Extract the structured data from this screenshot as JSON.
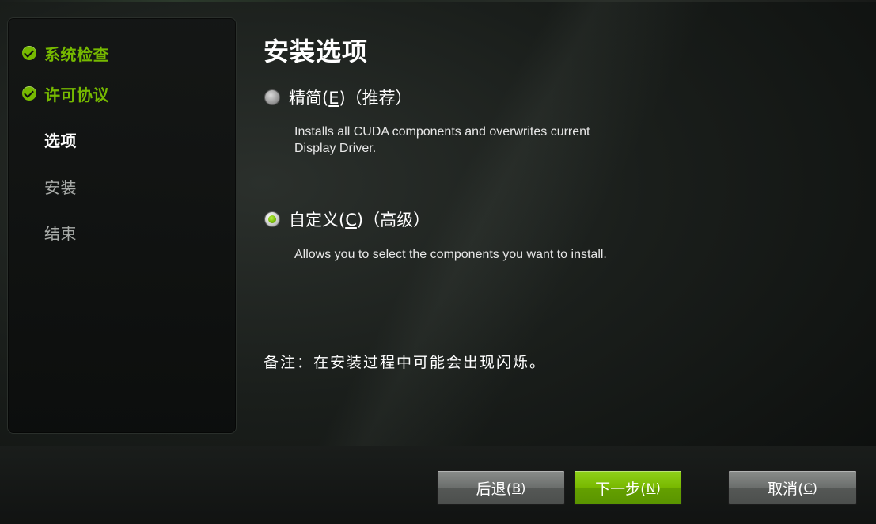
{
  "sidebar": {
    "steps": [
      {
        "label": "系统检查",
        "state": "done"
      },
      {
        "label": "许可协议",
        "state": "done"
      },
      {
        "label": "选项",
        "state": "current"
      },
      {
        "label": "安装",
        "state": "pending"
      },
      {
        "label": "结束",
        "state": "pending"
      }
    ]
  },
  "main": {
    "title": "安装选项",
    "options": [
      {
        "label_prefix": "精简(",
        "shortcut": "E",
        "label_suffix": ")（推荐）",
        "description_line1": "Installs all CUDA components and overwrites current",
        "description_line2": "Display Driver.",
        "selected": false
      },
      {
        "label_prefix": "自定义(",
        "shortcut": "C",
        "label_suffix": ")（高级）",
        "description_line1": "Allows you to select the components you want to install.",
        "selected": true
      }
    ],
    "note": "备注：在安装过程中可能会出现闪烁。"
  },
  "footer": {
    "back": {
      "label": "后退(",
      "shortcut": "B",
      "suffix": ")"
    },
    "next": {
      "label": "下一步(",
      "shortcut": "N",
      "suffix": ")"
    },
    "cancel": {
      "label": "取消(",
      "shortcut": "C",
      "suffix": ")"
    }
  },
  "colors": {
    "accent_green": "#76b900",
    "background": "#101311",
    "pending_text": "#a8aba8"
  },
  "icons": {
    "done_step": "check-circle-icon",
    "option_radio": "radio-button"
  }
}
